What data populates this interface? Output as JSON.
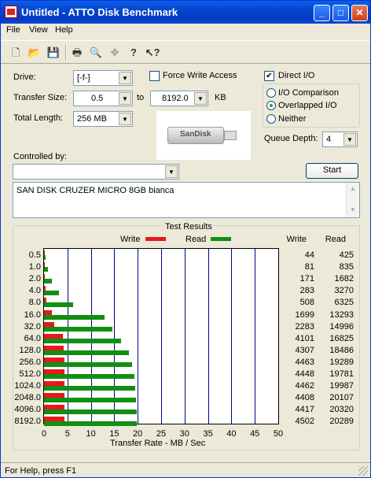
{
  "window": {
    "title": "Untitled - ATTO Disk Benchmark"
  },
  "menu": [
    "File",
    "View",
    "Help"
  ],
  "toolbar_icons": [
    "new-icon",
    "open-icon",
    "save-icon",
    "print-icon",
    "print-preview-icon",
    "move-icon",
    "help-icon",
    "context-help-icon"
  ],
  "form": {
    "drive_label": "Drive:",
    "drive_value": "[-f-]",
    "transfer_label": "Transfer Size:",
    "transfer_from": "0.5",
    "to_label": "to",
    "transfer_to": "8192.0",
    "kb_label": "KB",
    "length_label": "Total Length:",
    "length_value": "256 MB",
    "force_write": "Force Write Access",
    "force_write_checked": false,
    "direct_io": "Direct I/O",
    "direct_io_checked": true,
    "io_comparison": "I/O Comparison",
    "overlapped_io": "Overlapped I/O",
    "neither": "Neither",
    "io_selected": "overlapped",
    "queue_label": "Queue Depth:",
    "queue_value": "4",
    "controlled_label": "Controlled by:",
    "controlled_value": "",
    "start_label": "Start",
    "logo_text": "SanDisk",
    "description": "SAN DISK CRUZER MICRO 8GB bianca"
  },
  "results": {
    "title": "Test Results",
    "write_legend": "Write",
    "read_legend": "Read",
    "write_header": "Write",
    "read_header": "Read",
    "xlabel": "Transfer Rate - MB / Sec"
  },
  "chart_data": {
    "type": "bar",
    "title": "Test Results",
    "xlabel": "Transfer Rate - MB / Sec",
    "xlim": [
      0,
      50
    ],
    "xticks": [
      "0",
      "5",
      "10",
      "15",
      "20",
      "25",
      "30",
      "35",
      "40",
      "45",
      "50"
    ],
    "categories": [
      "0.5",
      "1.0",
      "2.0",
      "4.0",
      "8.0",
      "16.0",
      "32.0",
      "64.0",
      "128.0",
      "256.0",
      "512.0",
      "1024.0",
      "2048.0",
      "4096.0",
      "8192.0"
    ],
    "series": [
      {
        "name": "Write",
        "color": "#e5191e",
        "values": [
          44,
          81,
          171,
          283,
          508,
          1699,
          2283,
          4101,
          4307,
          4463,
          4448,
          4462,
          4408,
          4417,
          4502
        ]
      },
      {
        "name": "Read",
        "color": "#128f12",
        "values": [
          425,
          835,
          1682,
          3270,
          6325,
          13293,
          14996,
          16825,
          18486,
          19289,
          19781,
          19987,
          20107,
          20320,
          20289
        ]
      }
    ]
  },
  "status": {
    "text": "For Help, press F1"
  }
}
